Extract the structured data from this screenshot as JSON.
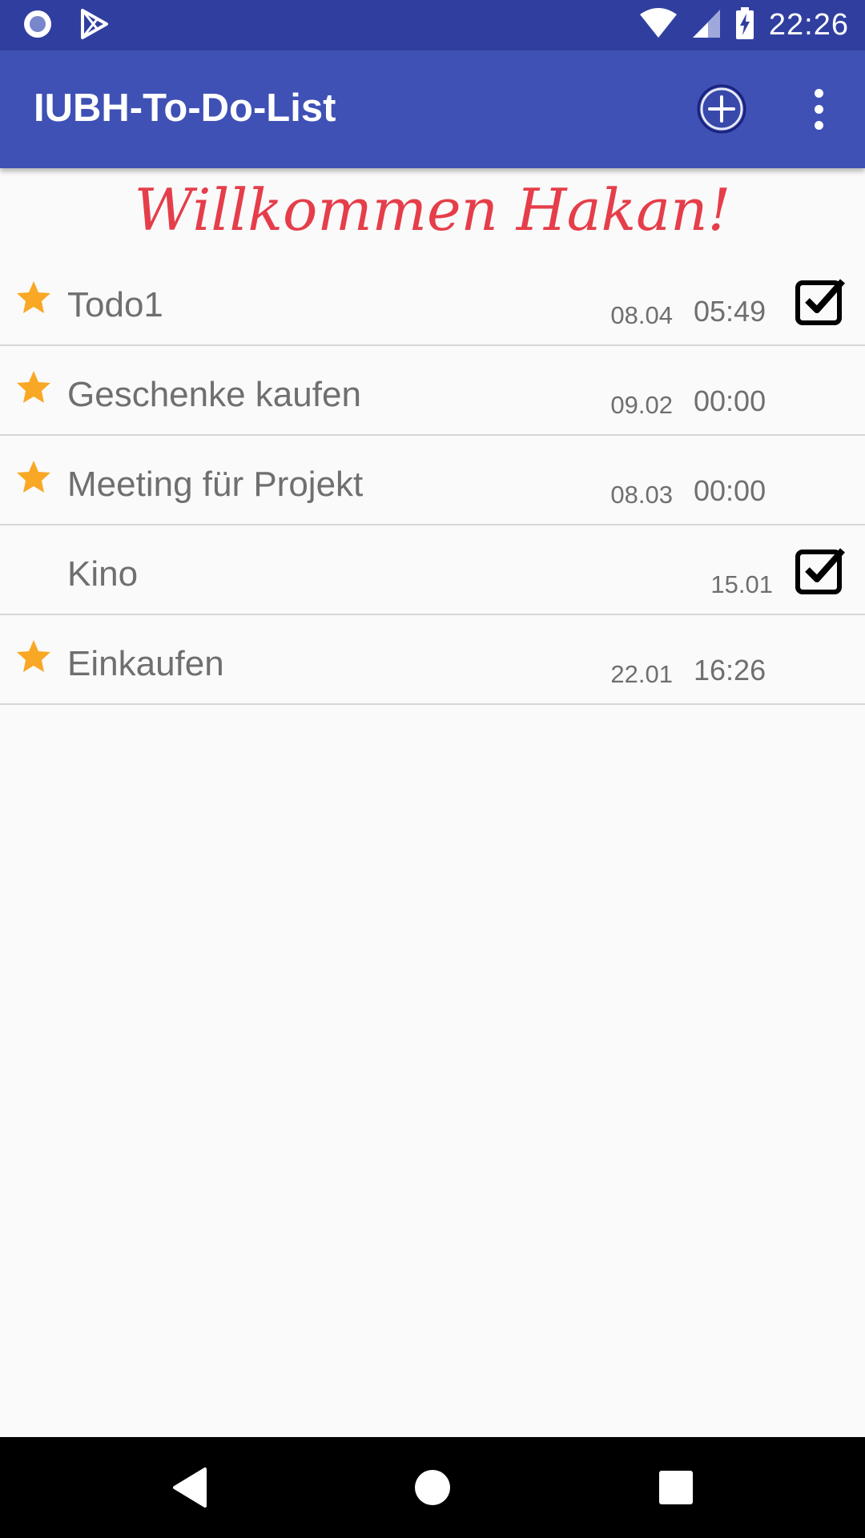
{
  "status_bar": {
    "time": "22:26",
    "left_icons": [
      "record-icon",
      "play-store-icon"
    ],
    "right_icons": [
      "wifi-icon",
      "cell-signal-icon",
      "battery-charging-icon"
    ]
  },
  "app_bar": {
    "title": "IUBH-To-Do-List",
    "actions": [
      "add-circle-icon",
      "more-vert-icon"
    ],
    "color": "#3f51b5"
  },
  "welcome": {
    "text": "Willkommen Hakan!",
    "color": "#e53e4a"
  },
  "todos": [
    {
      "title": "Todo1",
      "date": "08.04",
      "time": "05:49",
      "starred": true,
      "checked": true
    },
    {
      "title": "Geschenke kaufen",
      "date": "09.02",
      "time": "00:00",
      "starred": true,
      "checked": false
    },
    {
      "title": "Meeting für Projekt",
      "date": "08.03",
      "time": "00:00",
      "starred": true,
      "checked": false
    },
    {
      "title": "Kino",
      "date": "15.01",
      "time": "",
      "starred": false,
      "checked": true
    },
    {
      "title": "Einkaufen",
      "date": "22.01",
      "time": "16:26",
      "starred": true,
      "checked": false
    }
  ],
  "colors": {
    "status_bar": "#303f9f",
    "star": "#f9a825",
    "text_gray": "#6f6f6f"
  },
  "nav_bar": {
    "buttons": [
      "back-icon",
      "home-icon",
      "recents-icon"
    ]
  }
}
